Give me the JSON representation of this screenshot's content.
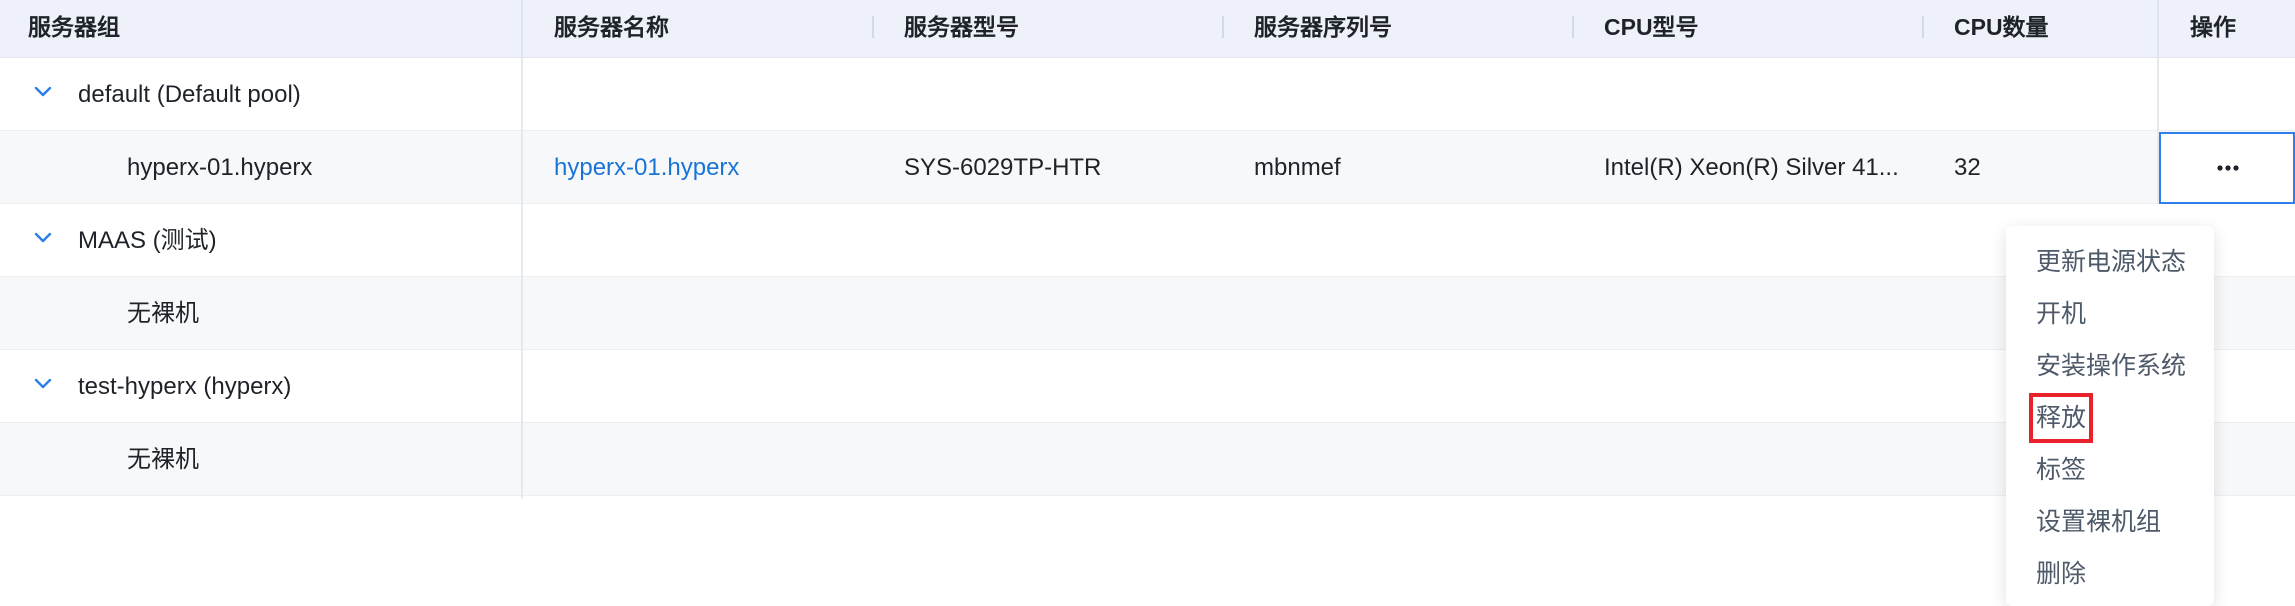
{
  "table": {
    "headers": [
      "服务器组",
      "服务器名称",
      "服务器型号",
      "服务器序列号",
      "CPU型号",
      "CPU数量",
      "操作"
    ],
    "groups": [
      {
        "label": "default (Default pool)",
        "child": {
          "group_cell": "hyperx-01.hyperx",
          "name": "hyperx-01.hyperx",
          "model": "SYS-6029TP-HTR",
          "serial": "mbnmef",
          "cpu_model": "Intel(R) Xeon(R) Silver 41...",
          "cpu_count": "32"
        }
      },
      {
        "label": "MAAS (测试)",
        "child": {
          "group_cell": "无裸机"
        }
      },
      {
        "label": "test-hyperx (hyperx)",
        "child": {
          "group_cell": "无裸机"
        }
      }
    ]
  },
  "actions_menu": {
    "items": [
      "更新电源状态",
      "开机",
      "安装操作系统",
      "释放",
      "标签",
      "设置裸机组",
      "删除"
    ],
    "highlighted": "释放"
  },
  "colors": {
    "header_bg": "#eef1f9",
    "link": "#1a74d6",
    "chevron": "#2b7de9",
    "highlight_border": "#e8212b",
    "active_button_border": "#2f80ed"
  },
  "icons": {
    "expand": "chevron-down-icon",
    "more": "more-dots-icon"
  }
}
